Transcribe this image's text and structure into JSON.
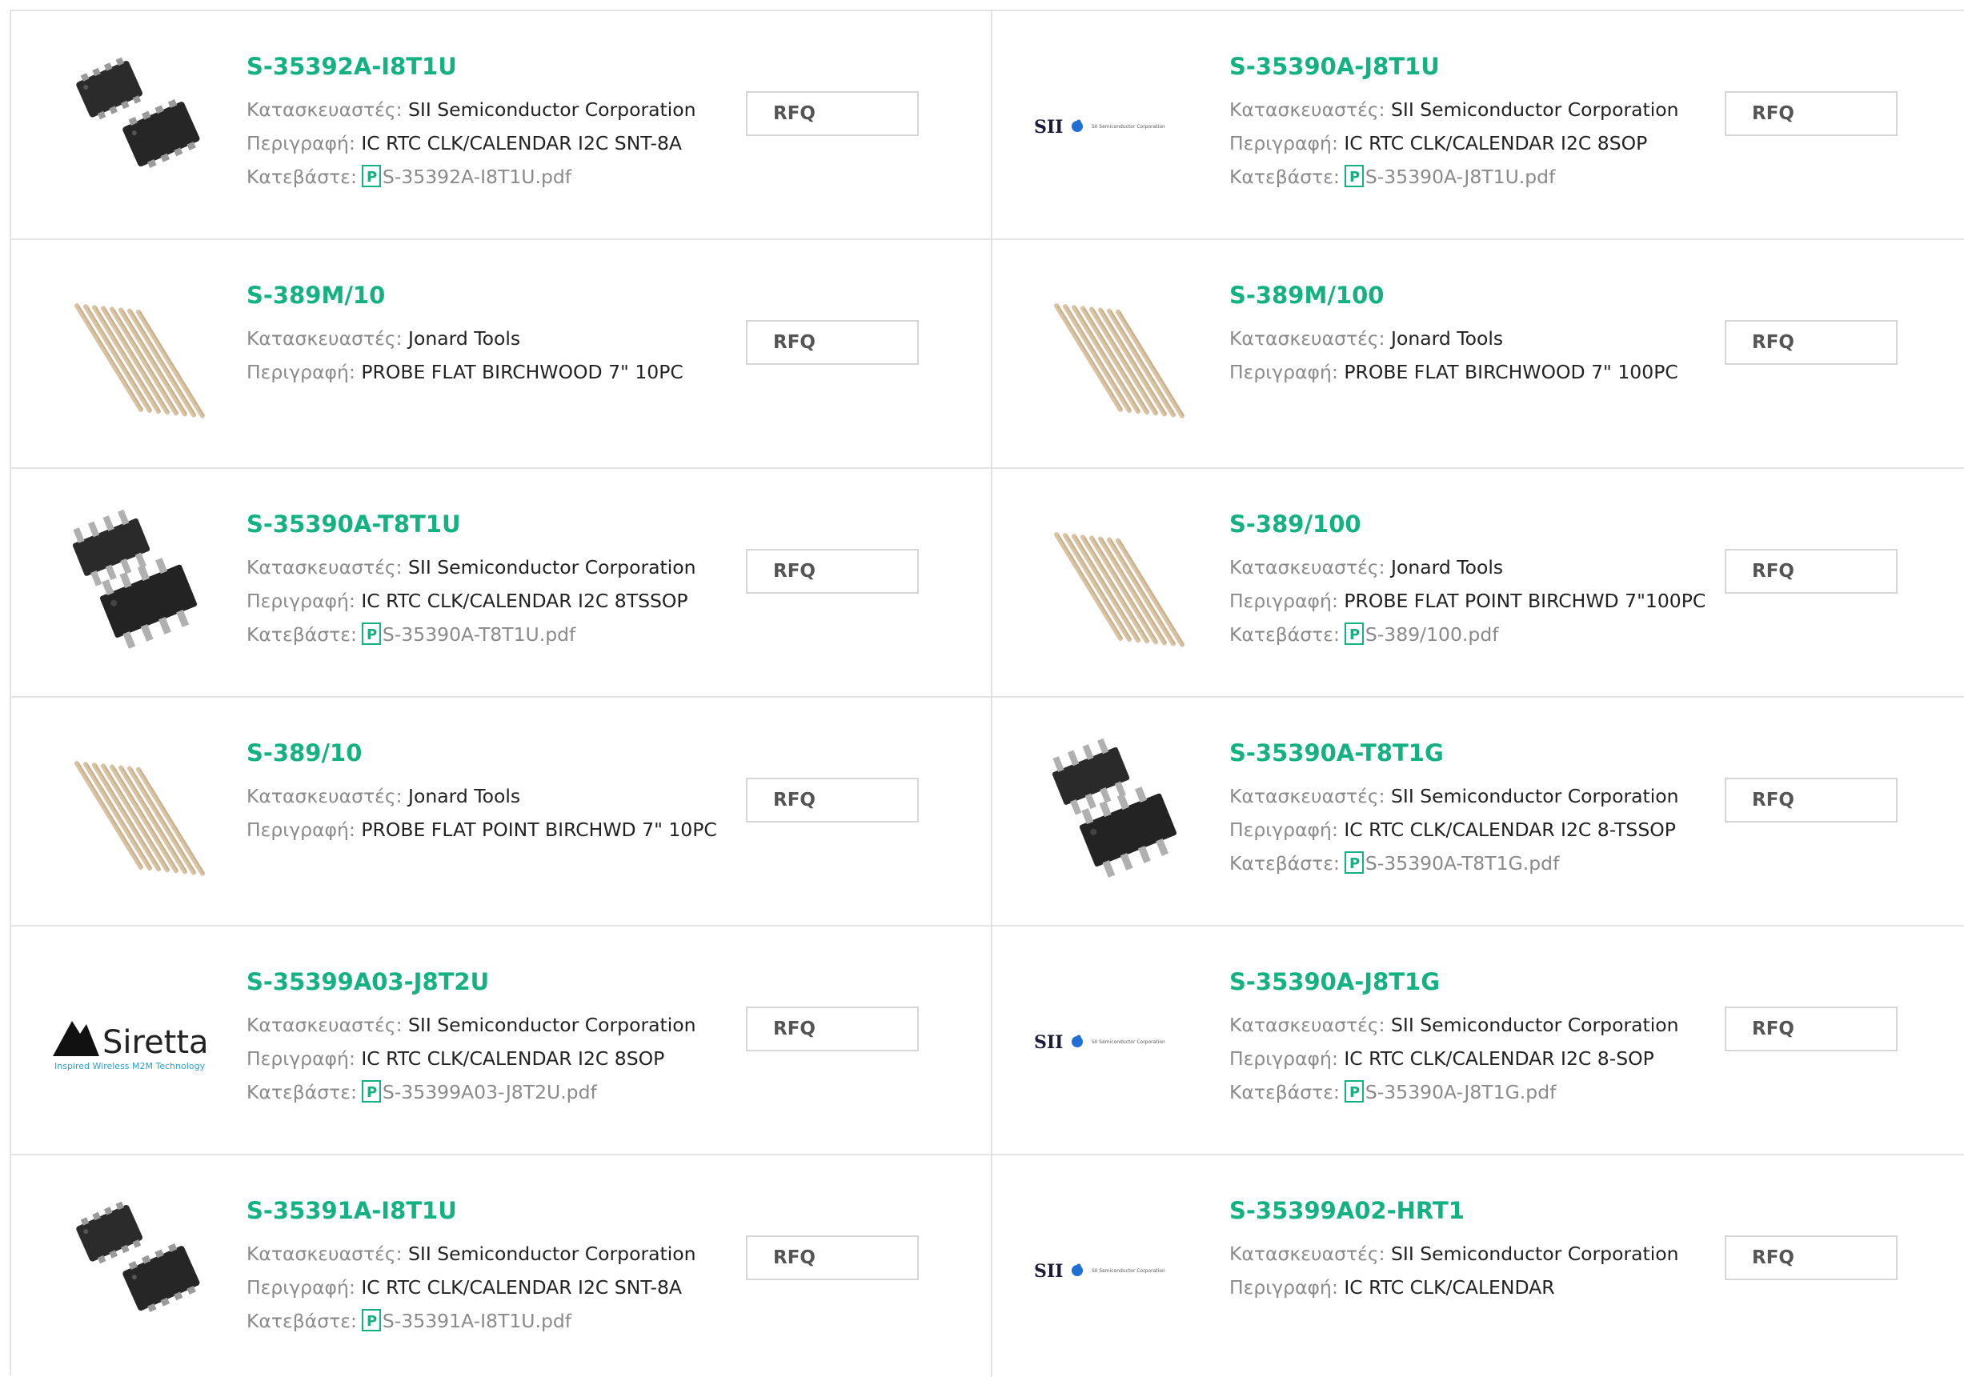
{
  "labels": {
    "manufacturer": "Κατασκευαστές:",
    "description": "Περιγραφή:",
    "download": "Κατεβάστε:",
    "rfq": "RFQ"
  },
  "colors": {
    "accent": "#14b183",
    "label": "#8a8a8a",
    "border": "#e3e3e3"
  },
  "products": [
    {
      "part": "S-35392A-I8T1U",
      "manufacturer": "SII Semiconductor Corporation",
      "description": "IC RTC CLK/CALENDAR I2C SNT-8A",
      "datasheet": "S-35392A-I8T1U.pdf",
      "image": "snt8-chip"
    },
    {
      "part": "S-35390A-J8T1U",
      "manufacturer": "SII Semiconductor Corporation",
      "description": "IC RTC CLK/CALENDAR I2C 8SOP",
      "datasheet": "S-35390A-J8T1U.pdf",
      "image": "sii-logo",
      "logo_text": "SII",
      "logo_subtext": "SII Semiconductor Corporation"
    },
    {
      "part": "S-389M/10",
      "manufacturer": "Jonard Tools",
      "description": "PROBE FLAT BIRCHWOOD 7\" 10PC",
      "image": "wood-probes"
    },
    {
      "part": "S-389M/100",
      "manufacturer": "Jonard Tools",
      "description": "PROBE FLAT BIRCHWOOD 7\" 100PC",
      "image": "wood-probes"
    },
    {
      "part": "S-35390A-T8T1U",
      "manufacturer": "SII Semiconductor Corporation",
      "description": "IC RTC CLK/CALENDAR I2C 8TSSOP",
      "datasheet": "S-35390A-T8T1U.pdf",
      "image": "tssop-chip"
    },
    {
      "part": "S-389/100",
      "manufacturer": "Jonard Tools",
      "description": "PROBE FLAT POINT BIRCHWD 7\"100PC",
      "datasheet": "S-389/100.pdf",
      "image": "wood-probes"
    },
    {
      "part": "S-389/10",
      "manufacturer": "Jonard Tools",
      "description": "PROBE FLAT POINT BIRCHWD 7\" 10PC",
      "image": "wood-probes"
    },
    {
      "part": "S-35390A-T8T1G",
      "manufacturer": "SII Semiconductor Corporation",
      "description": "IC RTC CLK/CALENDAR I2C 8-TSSOP",
      "datasheet": "S-35390A-T8T1G.pdf",
      "image": "tssop-chip"
    },
    {
      "part": "S-35399A03-J8T2U",
      "manufacturer": "SII Semiconductor Corporation",
      "description": "IC RTC CLK/CALENDAR I2C 8SOP",
      "datasheet": "S-35399A03-J8T2U.pdf",
      "image": "siretta-logo",
      "logo_text": "Siretta",
      "logo_subtext": "Inspired Wireless M2M Technology"
    },
    {
      "part": "S-35390A-J8T1G",
      "manufacturer": "SII Semiconductor Corporation",
      "description": "IC RTC CLK/CALENDAR I2C 8-SOP",
      "datasheet": "S-35390A-J8T1G.pdf",
      "image": "sii-logo",
      "logo_text": "SII",
      "logo_subtext": "SII Semiconductor Corporation"
    },
    {
      "part": "S-35391A-I8T1U",
      "manufacturer": "SII Semiconductor Corporation",
      "description": "IC RTC CLK/CALENDAR I2C SNT-8A",
      "datasheet": "S-35391A-I8T1U.pdf",
      "image": "snt8-chip"
    },
    {
      "part": "S-35399A02-HRT1",
      "manufacturer": "SII Semiconductor Corporation",
      "description": "IC RTC CLK/CALENDAR",
      "image": "sii-logo",
      "logo_text": "SII",
      "logo_subtext": "SII Semiconductor Corporation"
    }
  ]
}
